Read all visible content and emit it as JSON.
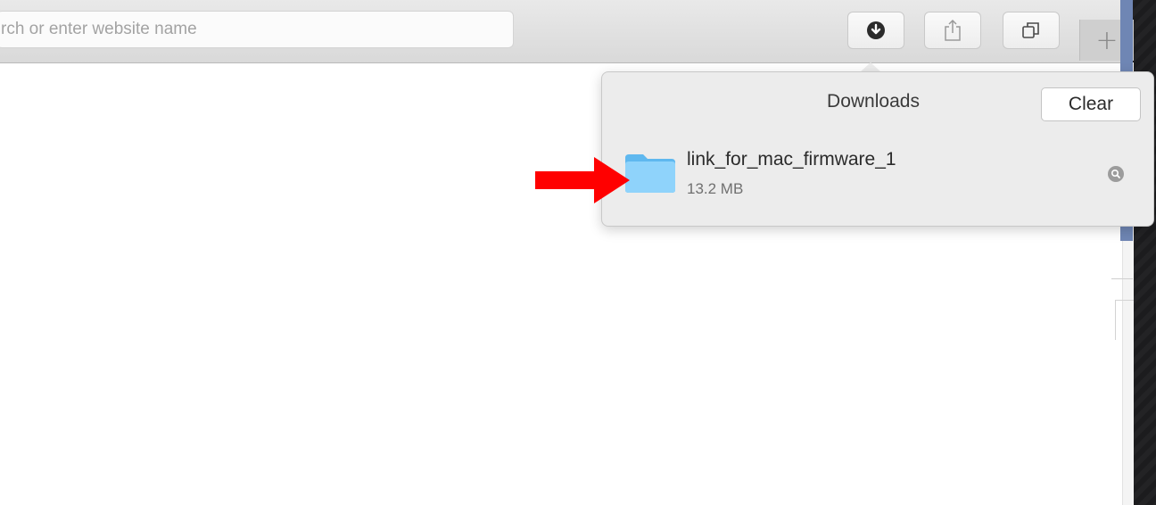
{
  "address_bar": {
    "placeholder": "rch or enter website name"
  },
  "toolbar": {
    "downloads_icon": "download-circle-icon",
    "share_icon": "share-icon",
    "tabs_icon": "tab-overview-icon",
    "new_tab_label": "+"
  },
  "downloads_popover": {
    "title": "Downloads",
    "clear_label": "Clear",
    "items": [
      {
        "name": "link_for_mac_firmware_1",
        "size": "13.2 MB",
        "icon": "folder-icon",
        "action_icon": "magnifier-icon"
      }
    ]
  },
  "annotation": {
    "color": "#ff0000",
    "shape": "arrow-right"
  },
  "colors": {
    "folder": "#6ec6f5",
    "annotation": "#ff0000"
  }
}
